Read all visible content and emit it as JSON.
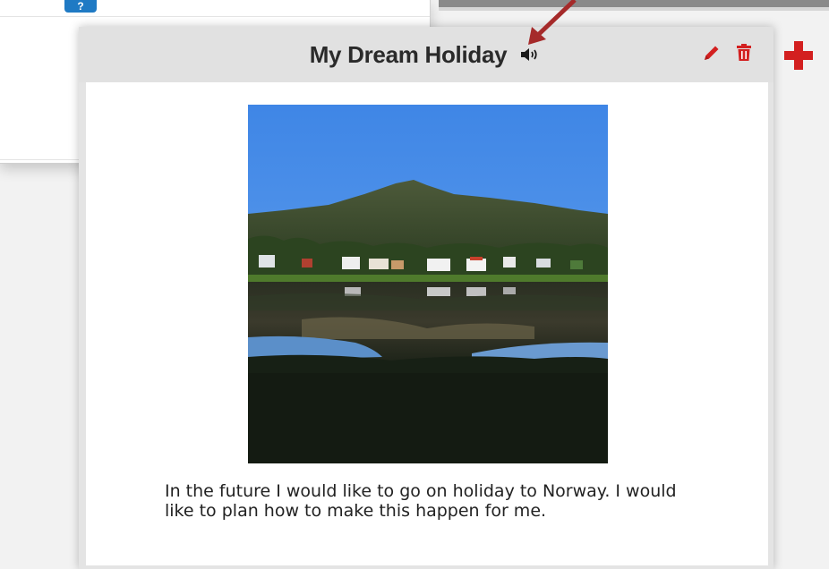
{
  "background_window": {
    "badge": "?"
  },
  "card": {
    "title": "My Dream Holiday",
    "caption": "In the future I would like to go on holiday to Norway. I would like to plan how to make this happen for me."
  },
  "icons": {
    "speaker": "speaker-icon",
    "edit": "pencil-icon",
    "delete": "trash-icon",
    "add": "plus-icon",
    "annotation": "arrow-annotation"
  },
  "colors": {
    "accent_red": "#d32020",
    "arrow": "#a52a2a",
    "header_bg": "#e1e1e1"
  },
  "image": {
    "subject": "lake-mountain-photo"
  }
}
